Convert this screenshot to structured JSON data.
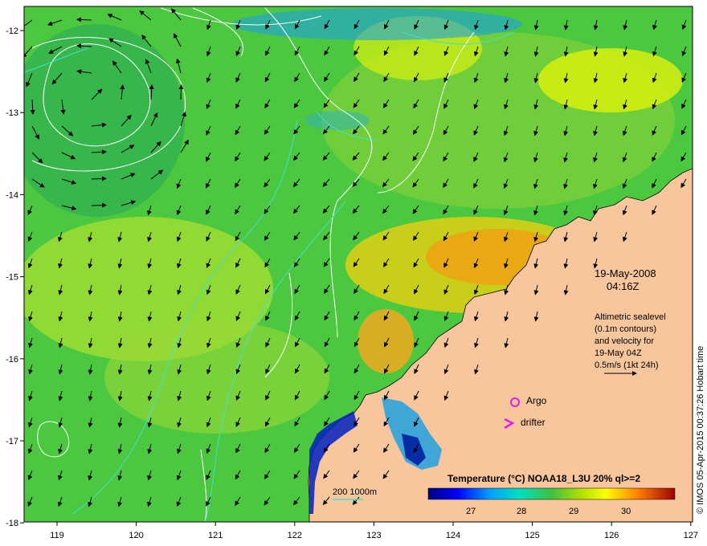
{
  "map": {
    "date": "19-May-2008",
    "time": "04:16Z",
    "altimetry_lines": [
      "Altimetric sealevel",
      "(0.1m contours)",
      "and velocity for",
      "19-May 04Z",
      "0.5m/s (1kt 24h)"
    ],
    "legend": {
      "argo": "Argo",
      "drifter": "drifter",
      "depth": "200  1000m"
    },
    "colorbar": {
      "title": "Temperature (°C) NOAA18_L3U 20% ql>=2",
      "ticks": [
        "27",
        "28",
        "29",
        "30"
      ]
    },
    "credit": "© IMOS 05-Apr-2015 00:37:26 Hobart time",
    "axes": {
      "x_ticks": [
        "119",
        "120",
        "121",
        "122",
        "123",
        "124",
        "125",
        "126",
        "127"
      ],
      "y_ticks": [
        "-12",
        "-13",
        "-14",
        "-15",
        "-16",
        "-17",
        "-18"
      ]
    },
    "colors": {
      "land": "#f7c69c",
      "contour": "#ffffff",
      "bathy": "#40e0d0",
      "argo": "#e01ee0",
      "drifter": "#e01ee0"
    }
  }
}
